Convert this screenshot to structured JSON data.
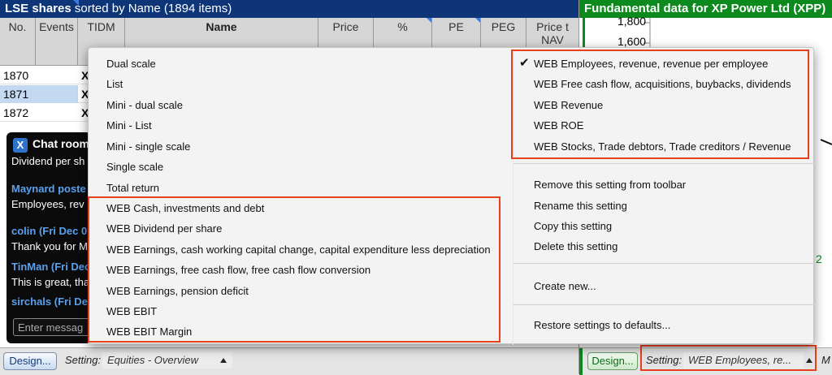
{
  "left_pane": {
    "title_bold": "LSE shares",
    "title_rest": " sorted by Name (1894 items)",
    "columns": [
      "No.",
      "Events",
      "TIDM",
      "Name",
      "Price",
      "%",
      "PE",
      "PEG",
      "Price t NAV"
    ],
    "rows": [
      {
        "no": "1870",
        "tidm": "X"
      },
      {
        "no": "1871",
        "tidm": "X"
      },
      {
        "no": "1872",
        "tidm": "X"
      }
    ],
    "toolbar": {
      "design_label": "Design...",
      "setting_label": "Setting:",
      "setting_value": "Equities - Overview"
    }
  },
  "chat": {
    "close_label": "X",
    "title": "Chat room",
    "messages": [
      {
        "user": "",
        "text": "Dividend per sh"
      },
      {
        "user": "Maynard poste",
        "text": "Employees, rev"
      },
      {
        "user": "colin (Fri Dec 0",
        "text": "Thank you for M"
      },
      {
        "user": "TinMan (Fri Dec",
        "text": "This is great, tha"
      },
      {
        "user": "sirchals (Fri De",
        "text": ""
      }
    ],
    "input_placeholder": "Enter messag"
  },
  "right_pane": {
    "title": "Fundamental data for XP Power Ltd (XPP)",
    "y_ticks": [
      "1,800",
      "1,600"
    ],
    "partial_label": "2",
    "toolbar": {
      "design_label": "Design...",
      "setting_label": "Setting:",
      "setting_value": "WEB Employees, re...",
      "trailing": "M"
    }
  },
  "menu": {
    "left_items": [
      "Dual scale",
      "List",
      "Mini - dual scale",
      "Mini - List",
      "Mini - single scale",
      "Single scale",
      "Total return",
      "WEB Cash, investments and debt",
      "WEB Dividend per share",
      "WEB Earnings, cash working capital change, capital expenditure less depreciation",
      "WEB Earnings, free cash flow, free cash flow conversion",
      "WEB Earnings, pension deficit",
      "WEB EBIT",
      "WEB EBIT Margin"
    ],
    "right_web_items": [
      "WEB Employees, revenue, revenue per employee",
      "WEB Free cash flow, acquisitions, buybacks, dividends",
      "WEB Revenue",
      "WEB ROE",
      "WEB Stocks, Trade debtors, Trade creditors / Revenue"
    ],
    "checkmark": "✔",
    "actions": [
      "Remove this setting from toolbar",
      "Rename this setting",
      "Copy this setting",
      "Delete this setting"
    ],
    "create_new": "Create new...",
    "restore": "Restore settings to defaults..."
  },
  "colors": {
    "left_title_bg": "#0e3577",
    "right_title_bg": "#0c8a1d",
    "highlight": "#e8401c",
    "selected_row": "#c3d8f1"
  }
}
